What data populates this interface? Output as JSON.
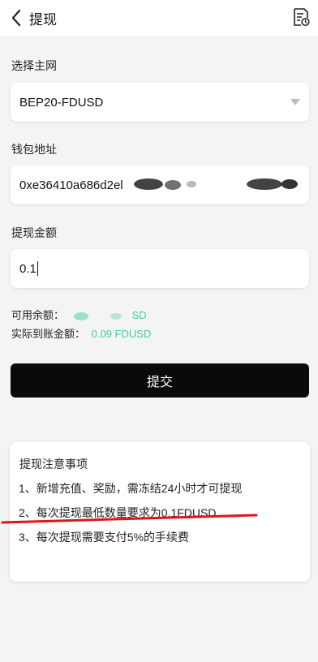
{
  "header": {
    "title": "提现",
    "back_icon": "chevron-left-icon",
    "record_icon": "records-icon"
  },
  "network": {
    "label": "选择主网",
    "value": "BEP20-FDUSD"
  },
  "wallet": {
    "label": "钱包地址",
    "value": "0xe36410a686d2el"
  },
  "amount": {
    "label": "提现金额",
    "value": "0.1"
  },
  "balance": {
    "label": "可用余额：",
    "value_suffix": "SD",
    "actual_label": "实际到账金额：",
    "actual_value": "0.09 FDUSD"
  },
  "submit_label": "提交",
  "notes": {
    "title": "提现注意事项",
    "items": [
      "1、新增充值、奖励，需冻结24小时才可提现",
      "2、每次提现最低数量要求为0.1FDUSD",
      "3、每次提现需要支付5%的手续费"
    ]
  },
  "colors": {
    "accent_green": "#3fcfa0",
    "button_bg": "#0a0a0a",
    "annotation_red": "#e0141c"
  }
}
